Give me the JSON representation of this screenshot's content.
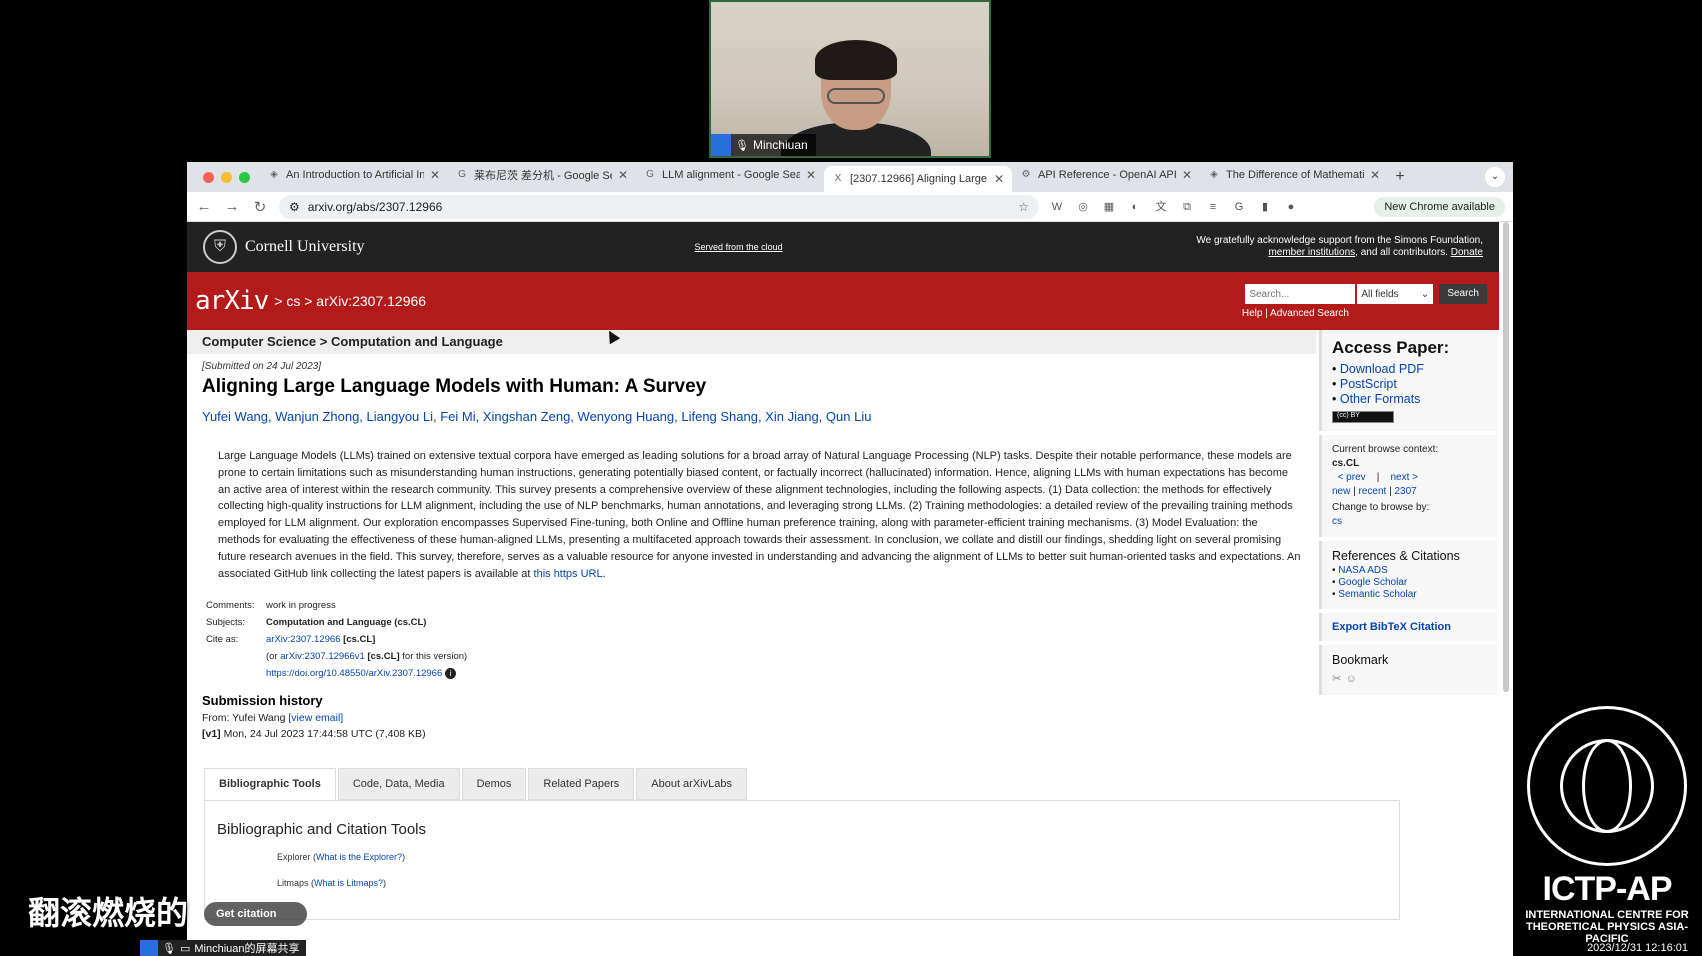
{
  "webcam": {
    "participant": "Minchiuan"
  },
  "browser": {
    "tabs": [
      {
        "icon": "ai-icon",
        "glyph": "◈",
        "title": "An Introduction to Artificial In"
      },
      {
        "icon": "google-icon",
        "glyph": "G",
        "title": "莱布尼茨 差分机 - Google Sear"
      },
      {
        "icon": "google-icon",
        "glyph": "G",
        "title": "LLM alignment - Google Sear"
      },
      {
        "icon": "arxiv-icon",
        "glyph": "X",
        "title": "[2307.12966] Aligning Large"
      },
      {
        "icon": "openai-icon",
        "glyph": "⚙",
        "title": "API Reference - OpenAI API"
      },
      {
        "icon": "ai-icon",
        "glyph": "◈",
        "title": "The Difference of Mathematic"
      }
    ],
    "active_tab": 3,
    "url": "arxiv.org/abs/2307.12966",
    "new_chrome": "New Chrome available"
  },
  "cornell": {
    "name": "Cornell University",
    "served": "Served from the cloud",
    "ack_line1": "We gratefully acknowledge support from the Simons Foundation,",
    "ack_members": "member institutions",
    "ack_mid": ", and all contributors.",
    "ack_donate": "Donate"
  },
  "arxiv": {
    "logo": "arXiv",
    "breadcrumb": "> cs > arXiv:2307.12966",
    "search_placeholder": "Search...",
    "field_select": "All fields",
    "search_button": "Search",
    "help": "Help",
    "sep": "|",
    "advanced": "Advanced Search"
  },
  "paper": {
    "subject_header": "Computer Science > Computation and Language",
    "submitted": "[Submitted on 24 Jul 2023]",
    "title": "Aligning Large Language Models with Human: A Survey",
    "authors": "Yufei Wang, Wanjun Zhong, Liangyou Li, Fei Mi, Xingshan Zeng, Wenyong Huang, Lifeng Shang, Xin Jiang, Qun Liu",
    "abstract": "Large Language Models (LLMs) trained on extensive textual corpora have emerged as leading solutions for a broad array of Natural Language Processing (NLP) tasks. Despite their notable performance, these models are prone to certain limitations such as misunderstanding human instructions, generating potentially biased content, or factually incorrect (hallucinated) information. Hence, aligning LLMs with human expectations has become an active area of interest within the research community. This survey presents a comprehensive overview of these alignment technologies, including the following aspects. (1) Data collection: the methods for effectively collecting high-quality instructions for LLM alignment, including the use of NLP benchmarks, human annotations, and leveraging strong LLMs. (2) Training methodologies: a detailed review of the prevailing training methods employed for LLM alignment. Our exploration encompasses Supervised Fine-tuning, both Online and Offline human preference training, along with parameter-efficient training mechanisms. (3) Model Evaluation: the methods for evaluating the effectiveness of these human-aligned LLMs, presenting a multifaceted approach towards their assessment. In conclusion, we collate and distill our findings, shedding light on several promising future research avenues in the field. This survey, therefore, serves as a valuable resource for anyone invested in understanding and advancing the alignment of LLMs to better suit human-oriented tasks and expectations. An associated GitHub link collecting the latest papers is available at ",
    "abstract_link": "this https URL",
    "abstract_end": ".",
    "comments_label": "Comments:",
    "comments": "work in progress",
    "subjects_label": "Subjects:",
    "subjects": "Computation and Language (cs.CL)",
    "cite_label": "Cite as:",
    "cite_id": "arXiv:2307.12966",
    "cite_cat": "[cs.CL]",
    "cite_or": "(or",
    "cite_v1": "arXiv:2307.12966v1",
    "cite_v1_cat": "[cs.CL]",
    "cite_v1_tail": "for this version)",
    "doi": "https://doi.org/10.48550/arXiv.2307.12966",
    "history_title": "Submission history",
    "from": "From: Yufei Wang",
    "view_email": "[view email]",
    "v1_label": "[v1]",
    "v1": "Mon, 24 Jul 2023 17:44:58 UTC (7,408 KB)"
  },
  "lower_tabs": [
    "Bibliographic Tools",
    "Code, Data, Media",
    "Demos",
    "Related Papers",
    "About arXivLabs"
  ],
  "panel": {
    "title": "Bibliographic and Citation Tools",
    "explorer": "Explorer (",
    "explorer_link": "What is the Explorer?",
    "explorer_end": ")",
    "litmaps": "Litmaps (",
    "litmaps_link": "What is Litmaps?",
    "litmaps_end": ")"
  },
  "sidebar": {
    "access_title": "Access Paper:",
    "access": [
      "Download PDF",
      "PostScript",
      "Other Formats"
    ],
    "cc": "(cc) BY",
    "context_label": "Current browse context:",
    "context": "cs.CL",
    "prev": "< prev",
    "sep1": "|",
    "next": "next >",
    "new": "new",
    "sep2": "|",
    "recent": "recent",
    "sep3": "|",
    "ym": "2307",
    "change": "Change to browse by:",
    "cs": "cs",
    "refs_title": "References & Citations",
    "refs": [
      "NASA ADS",
      "Google Scholar",
      "Semantic Scholar"
    ],
    "bibtex": "Export BibTeX Citation",
    "bookmark": "Bookmark"
  },
  "overlay": {
    "chinese": "翻滚燃烧的",
    "get_citation": "Get citation",
    "share": "Minchiuan的屏幕共享",
    "ictp_name": "ICTP-AP",
    "ictp_full1": "INTERNATIONAL CENTRE FOR",
    "ictp_full2": "THEORETICAL PHYSICS ASIA-PACIFIC",
    "timestamp": "2023/12/31 12:16:01"
  }
}
